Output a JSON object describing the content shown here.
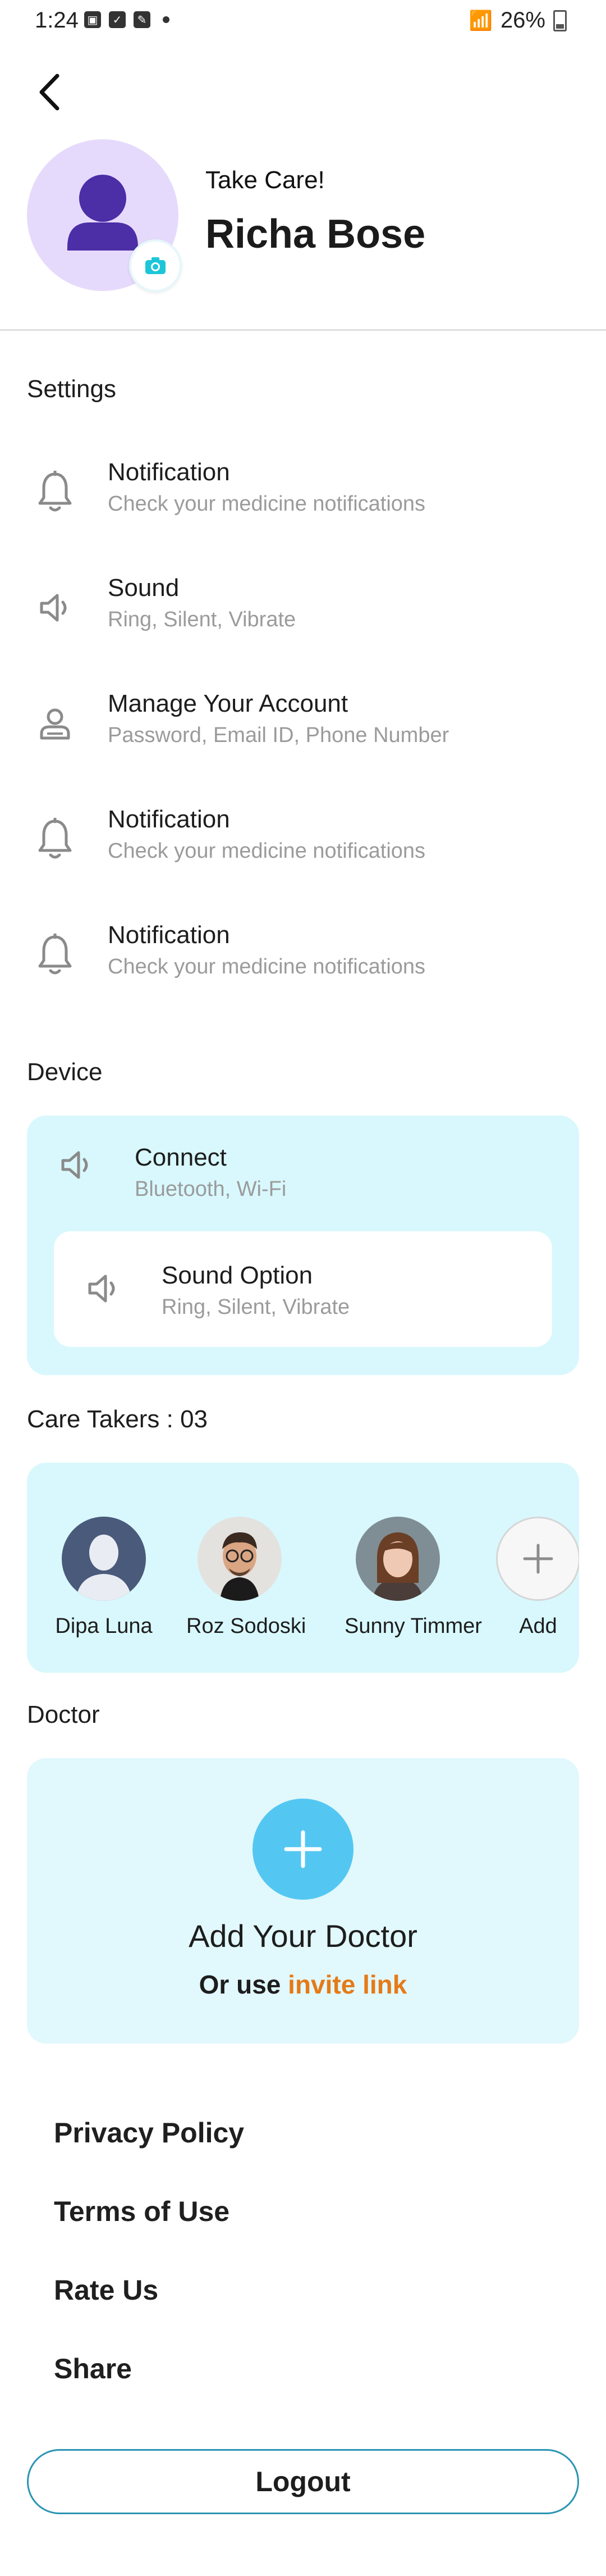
{
  "status_bar": {
    "time": "1:24",
    "battery": "26%"
  },
  "profile": {
    "greeting": "Take Care!",
    "name": "Richa Bose"
  },
  "settings": {
    "title": "Settings",
    "items": [
      {
        "title": "Notification",
        "subtitle": "Check your medicine notifications",
        "icon": "bell-icon"
      },
      {
        "title": "Sound",
        "subtitle": "Ring, Silent, Vibrate",
        "icon": "speaker-icon"
      },
      {
        "title": "Manage Your Account",
        "subtitle": "Password, Email ID, Phone Number",
        "icon": "user-icon"
      },
      {
        "title": "Notification",
        "subtitle": "Check your medicine notifications",
        "icon": "bell-icon"
      },
      {
        "title": "Notification",
        "subtitle": "Check your medicine notifications",
        "icon": "bell-icon"
      }
    ]
  },
  "device": {
    "title": "Device",
    "connect": {
      "title": "Connect",
      "subtitle": "Bluetooth, Wi-Fi"
    },
    "sound_option": {
      "title": "Sound Option",
      "subtitle": "Ring, Silent, Vibrate"
    }
  },
  "caretakers": {
    "title": "Care Takers : 03",
    "people": [
      {
        "name": "Dipa Luna"
      },
      {
        "name": "Roz Sodoski"
      },
      {
        "name": "Sunny Timmer"
      },
      {
        "name": "Add"
      }
    ]
  },
  "doctor": {
    "title": "Doctor",
    "add_label": "Add Your Doctor",
    "or_use": "Or use",
    "invite_link": "invite link"
  },
  "links": [
    "Privacy Policy",
    "Terms of Use",
    "Rate Us",
    "Share"
  ],
  "logout_label": "Logout",
  "colors": {
    "accent": "#53c7f2",
    "card_bg": "#d8f8fd",
    "link": "#e57a17",
    "avatar_bg": "#e6dafc"
  }
}
